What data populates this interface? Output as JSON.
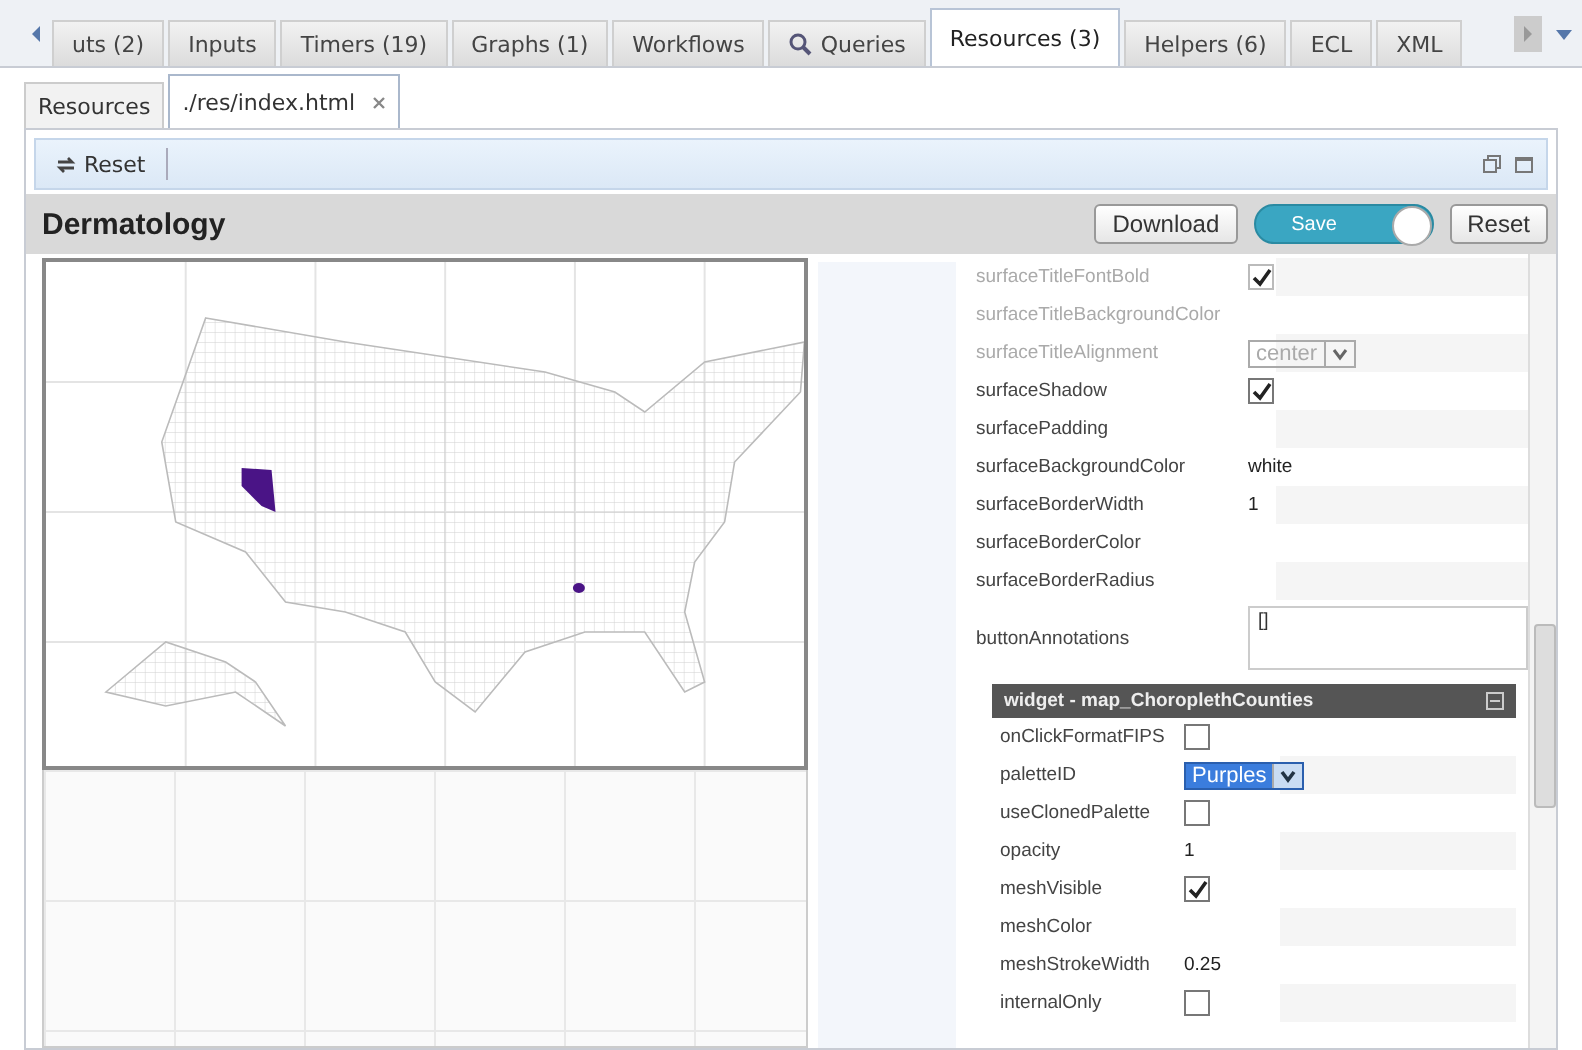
{
  "tabs": [
    {
      "label": "uts (2)",
      "selected": false,
      "kind": "plain"
    },
    {
      "label": "Inputs",
      "selected": false,
      "kind": "plain"
    },
    {
      "label": "Timers (19)",
      "selected": false,
      "kind": "plain"
    },
    {
      "label": "Graphs (1)",
      "selected": false,
      "kind": "plain"
    },
    {
      "label": "Workflows",
      "selected": false,
      "kind": "plain"
    },
    {
      "label": "Queries",
      "selected": false,
      "kind": "search"
    },
    {
      "label": "Resources (3)",
      "selected": true,
      "kind": "plain"
    },
    {
      "label": "Helpers (6)",
      "selected": false,
      "kind": "plain"
    },
    {
      "label": "ECL",
      "selected": false,
      "kind": "plain"
    },
    {
      "label": "XML",
      "selected": false,
      "kind": "plain"
    }
  ],
  "subtabs": [
    {
      "label": "Resources",
      "selected": false,
      "closable": false
    },
    {
      "label": "./res/index.html",
      "selected": true,
      "closable": true
    }
  ],
  "toolbar": {
    "reset": "Reset"
  },
  "header": {
    "title": "Dermatology",
    "download": "Download",
    "save": {
      "label": "Save",
      "on": true
    },
    "reset": "Reset"
  },
  "properties": [
    {
      "label": "surfaceTitleFontBold",
      "kind": "check",
      "checked": true,
      "disabled": true
    },
    {
      "label": "surfaceTitleBackgroundColor",
      "kind": "text",
      "disabled": true
    },
    {
      "label": "surfaceTitleAlignment",
      "kind": "select",
      "value": "center",
      "disabled": true
    },
    {
      "label": "surfaceShadow",
      "kind": "check",
      "checked": true,
      "disabled": false
    },
    {
      "label": "surfacePadding",
      "kind": "text",
      "disabled": false
    },
    {
      "label": "surfaceBackgroundColor",
      "kind": "text",
      "value": "white",
      "disabled": false
    },
    {
      "label": "surfaceBorderWidth",
      "kind": "text",
      "value": "1",
      "disabled": false
    },
    {
      "label": "surfaceBorderColor",
      "kind": "text",
      "disabled": false
    },
    {
      "label": "surfaceBorderRadius",
      "kind": "text",
      "disabled": false
    },
    {
      "label": "buttonAnnotations",
      "kind": "textarea",
      "value": "[]",
      "disabled": false
    }
  ],
  "widget": {
    "title": "widget - map_ChoroplethCounties",
    "rows": [
      {
        "label": "onClickFormatFIPS",
        "kind": "check",
        "checked": false
      },
      {
        "label": "paletteID",
        "kind": "select",
        "value": "Purples"
      },
      {
        "label": "useClonedPalette",
        "kind": "check",
        "checked": false
      },
      {
        "label": "opacity",
        "kind": "text",
        "value": "1"
      },
      {
        "label": "meshVisible",
        "kind": "check",
        "checked": true
      },
      {
        "label": "meshColor",
        "kind": "text"
      },
      {
        "label": "meshStrokeWidth",
        "kind": "text",
        "value": "0.25"
      },
      {
        "label": "internalOnly",
        "kind": "check",
        "checked": false
      }
    ]
  }
}
